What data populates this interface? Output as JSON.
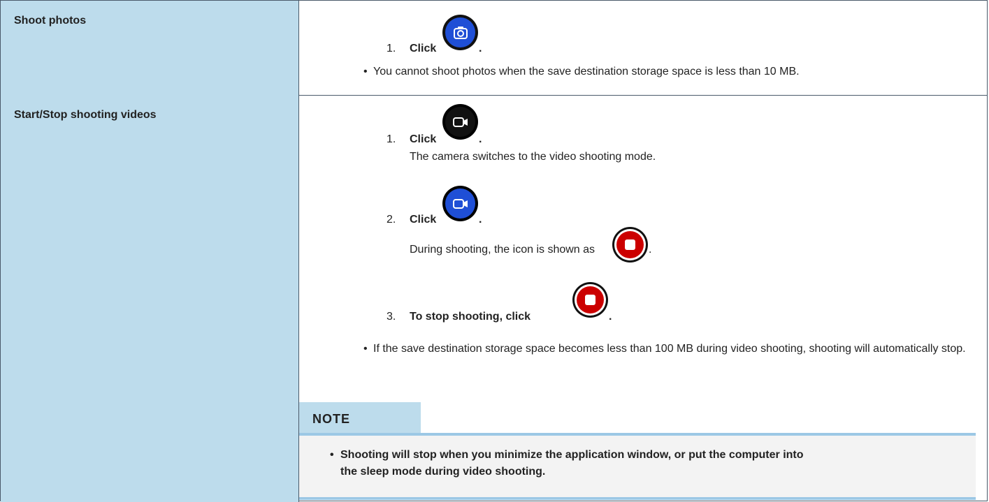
{
  "rows": [
    {
      "label": "Shoot photos",
      "steps": [
        {
          "num": "1.",
          "text": "Click",
          "suffix": "."
        }
      ],
      "bullets": [
        "You cannot shoot photos when the save destination storage space is less than 10 MB."
      ]
    },
    {
      "label": "Start/Stop shooting videos",
      "steps": [
        {
          "num": "1.",
          "text": "Click",
          "suffix": ".",
          "desc": "The camera switches to the video shooting mode."
        },
        {
          "num": "2.",
          "text": "Click",
          "suffix": ".",
          "desc": "During shooting, the icon is shown as",
          "desc_suffix": "."
        },
        {
          "num": "3.",
          "text": "To stop shooting, click",
          "suffix": "."
        }
      ],
      "bullets": [
        "If the save destination storage space becomes less than 100 MB during video shooting, shooting will automatically stop."
      ],
      "note": {
        "title": "NOTE",
        "items": [
          "Shooting will stop when you minimize the application window, or put the computer into the sleep mode during video shooting."
        ]
      }
    }
  ],
  "icons": {
    "photo": {
      "name": "camera-icon",
      "color": "#1f4fd6"
    },
    "video_mode": {
      "name": "video-mode-icon",
      "color": "#111111"
    },
    "video_record": {
      "name": "video-record-icon",
      "color": "#1f4fd6"
    },
    "stop": {
      "name": "stop-icon",
      "color": "#cc0000"
    }
  },
  "bullet_glyph": "•"
}
